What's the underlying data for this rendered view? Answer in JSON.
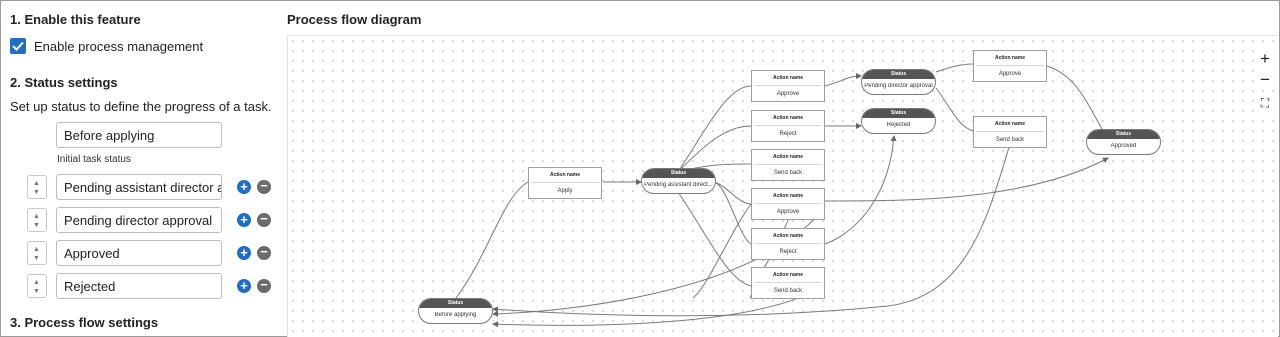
{
  "sections": {
    "enable_title": "1. Enable this feature",
    "enable_label": "Enable process management",
    "enable_checked": true,
    "status_title": "2. Status settings",
    "status_desc": "Set up status to define the progress of a task.",
    "initial_status": "Before applying",
    "initial_caption": "Initial task status",
    "statuses": [
      "Pending assistant director app",
      "Pending director approval",
      "Approved",
      "Rejected"
    ],
    "flow_title": "3. Process flow settings"
  },
  "diagram": {
    "title": "Process flow diagram",
    "zoom_in": "+",
    "zoom_out": "−",
    "fit": "⛶",
    "status_header": "Status",
    "action_header": "Action name",
    "status_nodes": {
      "before": "Before applying",
      "pending_assistant": "Pending assistant direct...",
      "pending_director": "Pending director approval",
      "rejected": "Rejected",
      "approved": "Approved"
    },
    "actions": {
      "apply": "Apply",
      "a_approve": "Approve",
      "a_reject": "Reject",
      "a_sendback": "Send back",
      "b_approve": "Approve",
      "b_reject": "Reject",
      "b_sendback": "Send back",
      "d_approve": "Approve",
      "d_sendback": "Send back"
    }
  },
  "colors": {
    "accent": "#1f6fc5",
    "status_header": "#555555",
    "remove": "#6b6b6b"
  }
}
